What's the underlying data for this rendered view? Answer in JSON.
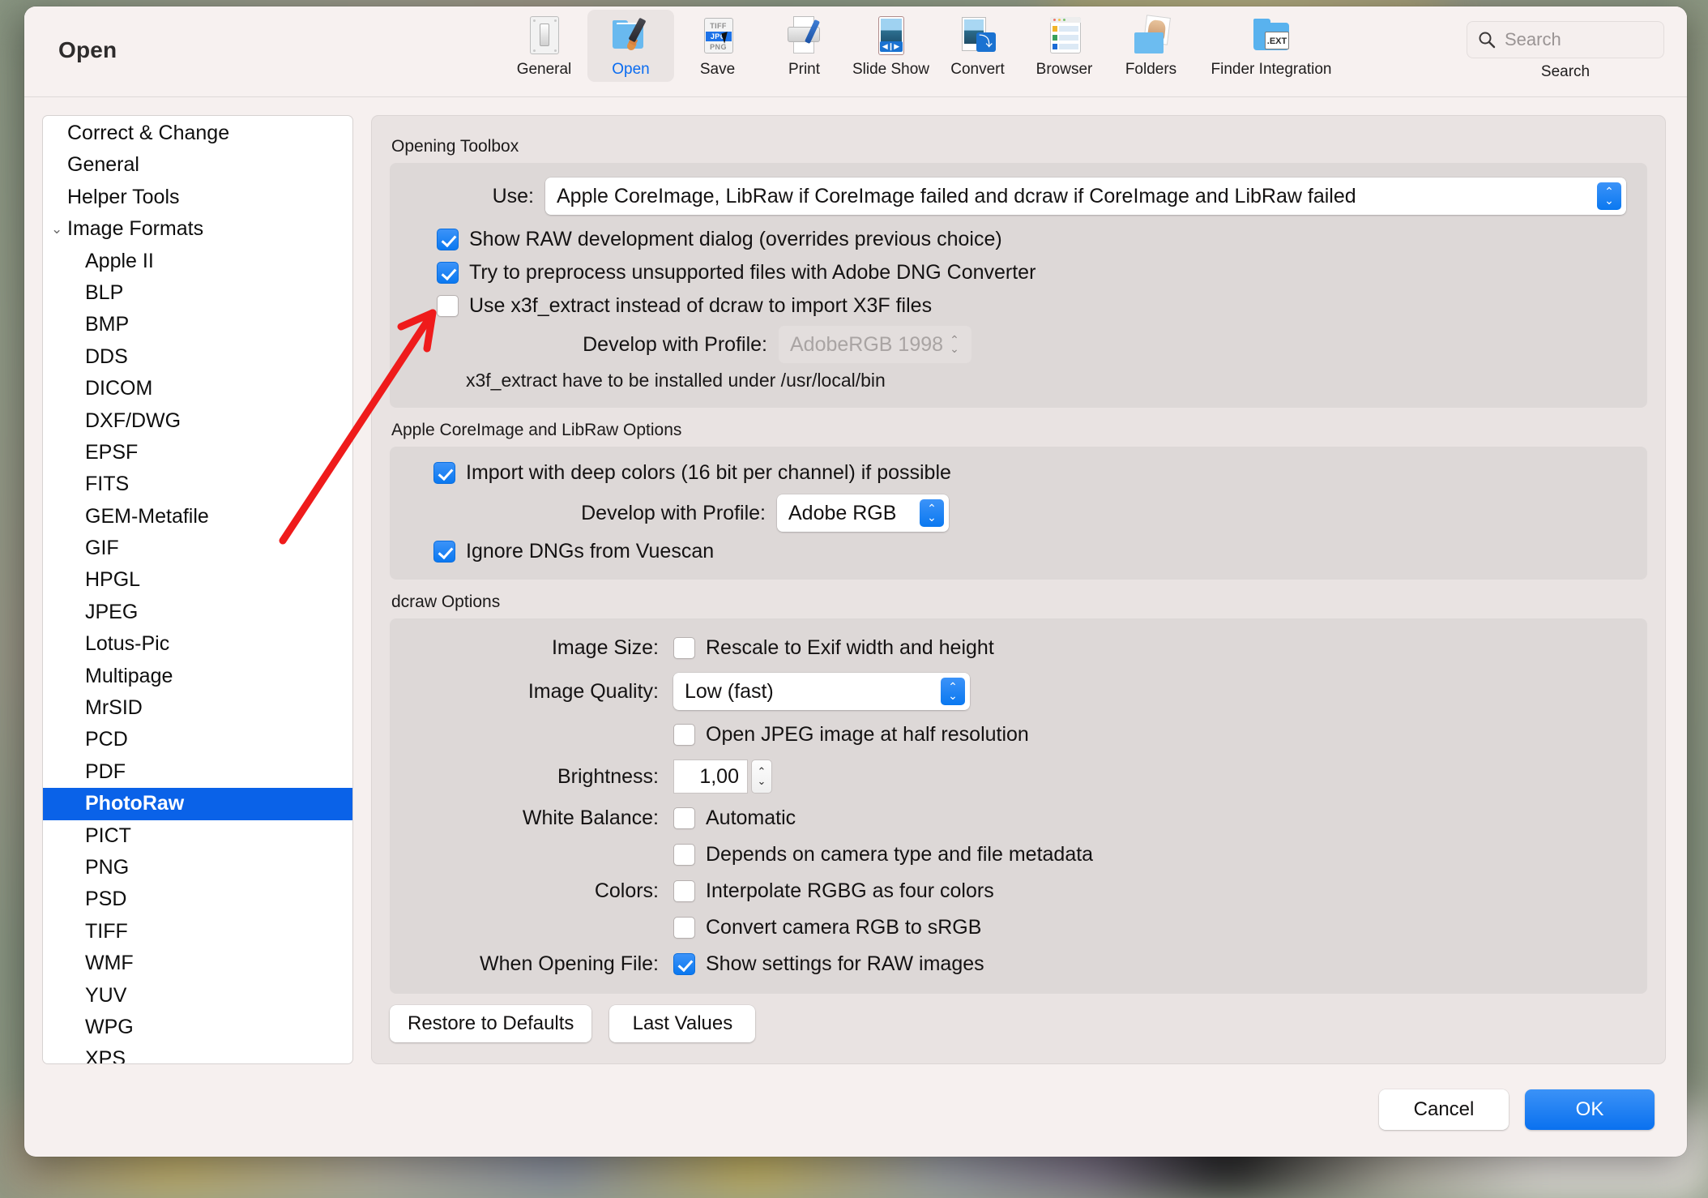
{
  "window": {
    "title": "Open"
  },
  "toolbar": {
    "items": [
      {
        "label": "General",
        "icon": "general-switch-icon",
        "selected": false
      },
      {
        "label": "Open",
        "icon": "open-folder-brush-icon",
        "selected": true
      },
      {
        "label": "Save",
        "icon": "save-formats-icon",
        "selected": false
      },
      {
        "label": "Print",
        "icon": "print-printer-icon",
        "selected": false
      },
      {
        "label": "Slide Show",
        "icon": "slideshow-icon",
        "selected": false
      },
      {
        "label": "Convert",
        "icon": "convert-icon",
        "selected": false
      },
      {
        "label": "Browser",
        "icon": "browser-icon",
        "selected": false
      },
      {
        "label": "Folders",
        "icon": "folders-icon",
        "selected": false
      },
      {
        "label": "Finder Integration",
        "icon": "finder-integration-icon",
        "selected": false
      }
    ],
    "save_icon_rows": [
      "TIFF",
      "JPG",
      "PNG"
    ],
    "finder_ext_label": ".EXT",
    "search": {
      "placeholder": "Search",
      "caption": "Search",
      "icon": "search-icon"
    }
  },
  "sidebar": {
    "items": [
      {
        "label": "Correct & Change",
        "level": 0,
        "selected": false,
        "twisty": ""
      },
      {
        "label": "General",
        "level": 0,
        "selected": false,
        "twisty": ""
      },
      {
        "label": "Helper Tools",
        "level": 0,
        "selected": false,
        "twisty": ""
      },
      {
        "label": "Image Formats",
        "level": 0,
        "selected": false,
        "twisty": "⌄"
      },
      {
        "label": "Apple II",
        "level": 1,
        "selected": false,
        "twisty": ""
      },
      {
        "label": "BLP",
        "level": 1,
        "selected": false,
        "twisty": ""
      },
      {
        "label": "BMP",
        "level": 1,
        "selected": false,
        "twisty": ""
      },
      {
        "label": "DDS",
        "level": 1,
        "selected": false,
        "twisty": ""
      },
      {
        "label": "DICOM",
        "level": 1,
        "selected": false,
        "twisty": ""
      },
      {
        "label": "DXF/DWG",
        "level": 1,
        "selected": false,
        "twisty": ""
      },
      {
        "label": "EPSF",
        "level": 1,
        "selected": false,
        "twisty": ""
      },
      {
        "label": "FITS",
        "level": 1,
        "selected": false,
        "twisty": ""
      },
      {
        "label": "GEM-Metafile",
        "level": 1,
        "selected": false,
        "twisty": ""
      },
      {
        "label": "GIF",
        "level": 1,
        "selected": false,
        "twisty": ""
      },
      {
        "label": "HPGL",
        "level": 1,
        "selected": false,
        "twisty": ""
      },
      {
        "label": "JPEG",
        "level": 1,
        "selected": false,
        "twisty": ""
      },
      {
        "label": "Lotus-Pic",
        "level": 1,
        "selected": false,
        "twisty": ""
      },
      {
        "label": "Multipage",
        "level": 1,
        "selected": false,
        "twisty": ""
      },
      {
        "label": "MrSID",
        "level": 1,
        "selected": false,
        "twisty": ""
      },
      {
        "label": "PCD",
        "level": 1,
        "selected": false,
        "twisty": ""
      },
      {
        "label": "PDF",
        "level": 1,
        "selected": false,
        "twisty": ""
      },
      {
        "label": "PhotoRaw",
        "level": 1,
        "selected": true,
        "twisty": ""
      },
      {
        "label": "PICT",
        "level": 1,
        "selected": false,
        "twisty": ""
      },
      {
        "label": "PNG",
        "level": 1,
        "selected": false,
        "twisty": ""
      },
      {
        "label": "PSD",
        "level": 1,
        "selected": false,
        "twisty": ""
      },
      {
        "label": "TIFF",
        "level": 1,
        "selected": false,
        "twisty": ""
      },
      {
        "label": "WMF",
        "level": 1,
        "selected": false,
        "twisty": ""
      },
      {
        "label": "YUV",
        "level": 1,
        "selected": false,
        "twisty": ""
      },
      {
        "label": "WPG",
        "level": 1,
        "selected": false,
        "twisty": ""
      },
      {
        "label": "XPS",
        "level": 1,
        "selected": false,
        "twisty": ""
      }
    ]
  },
  "opening_toolbox": {
    "title": "Opening Toolbox",
    "use_label": "Use:",
    "use_value": "Apple CoreImage, LibRaw if CoreImage failed and dcraw if CoreImage and LibRaw failed",
    "show_raw_dialog": {
      "label": "Show RAW development dialog (overrides previous choice)",
      "checked": true
    },
    "preprocess_dng": {
      "label": "Try to preprocess unsupported files with Adobe DNG Converter",
      "checked": true
    },
    "use_x3f_extract": {
      "label": "Use x3f_extract instead of dcraw to import X3F files",
      "checked": false
    },
    "profile_label": "Develop with Profile:",
    "profile_value": "AdobeRGB 1998",
    "profile_disabled": true,
    "hint": "x3f_extract have to be installed under /usr/local/bin"
  },
  "coreimage_options": {
    "title": "Apple CoreImage and LibRaw Options",
    "deep_colors": {
      "label": "Import with deep colors (16 bit per channel) if possible",
      "checked": true
    },
    "profile_label": "Develop with Profile:",
    "profile_value": "Adobe RGB",
    "ignore_dngs": {
      "label": "Ignore DNGs from Vuescan",
      "checked": true
    }
  },
  "dcraw_options": {
    "title": "dcraw Options",
    "image_size_label": "Image Size:",
    "rescale_exif": {
      "label": "Rescale to Exif width and height",
      "checked": false
    },
    "image_quality_label": "Image Quality:",
    "image_quality_value": "Low (fast)",
    "half_resolution": {
      "label": "Open JPEG image at half resolution",
      "checked": false
    },
    "brightness_label": "Brightness:",
    "brightness_value": "1,00",
    "white_balance_label": "White Balance:",
    "automatic": {
      "label": "Automatic",
      "checked": false
    },
    "depends_camera": {
      "label": "Depends on camera type and file metadata",
      "checked": false
    },
    "colors_label": "Colors:",
    "interpolate_rgbg": {
      "label": "Interpolate RGBG as four colors",
      "checked": false
    },
    "convert_srgb": {
      "label": "Convert camera RGB to sRGB",
      "checked": false
    },
    "when_opening_label": "When Opening File:",
    "show_raw_settings": {
      "label": "Show settings for RAW images",
      "checked": true
    }
  },
  "pane_buttons": {
    "restore": "Restore to Defaults",
    "last_values": "Last Values"
  },
  "footer": {
    "cancel": "Cancel",
    "ok": "OK"
  },
  "colors": {
    "accent": "#0a71ef",
    "selection": "#0a62e8",
    "annotation": "#ef1b1b"
  }
}
